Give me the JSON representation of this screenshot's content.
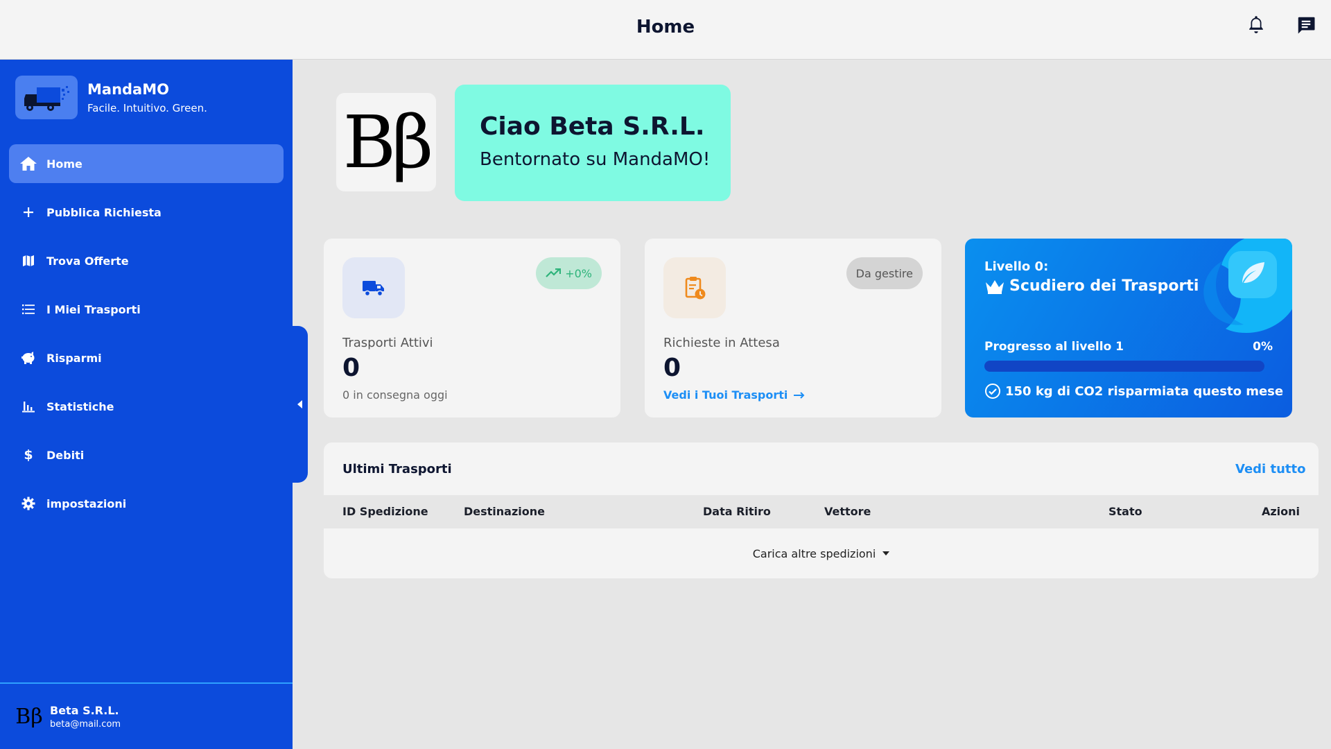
{
  "header": {
    "title": "Home"
  },
  "brand": {
    "name": "MandaMO",
    "tagline": "Facile. Intuitivo. Green."
  },
  "sidebar": {
    "items": [
      {
        "label": "Home",
        "icon": "home-icon",
        "active": true
      },
      {
        "label": "Pubblica Richiesta",
        "icon": "plus-icon"
      },
      {
        "label": "Trova Offerte",
        "icon": "map-icon"
      },
      {
        "label": "I Miei Trasporti",
        "icon": "list-icon"
      },
      {
        "label": "Risparmi",
        "icon": "piggy-bank-icon"
      },
      {
        "label": "Statistiche",
        "icon": "bar-chart-icon"
      },
      {
        "label": "Debiti",
        "icon": "dollar-icon"
      },
      {
        "label": "impostazioni",
        "icon": "gear-icon"
      }
    ]
  },
  "user": {
    "name": "Beta S.R.L.",
    "email": "beta@mail.com",
    "logo_text": "Bβ"
  },
  "greeting": {
    "title": "Ciao Beta S.R.L.",
    "subtitle": "Bentornato su MandaMO!"
  },
  "cards": {
    "active": {
      "label": "Trasporti Attivi",
      "value": "0",
      "footer": "0 in consegna oggi",
      "badge": "+0%"
    },
    "pending": {
      "label": "Richieste in Attesa",
      "value": "0",
      "link": "Vedi i Tuoi Trasporti",
      "badge": "Da gestire"
    }
  },
  "level": {
    "label": "Livello 0:",
    "name": "Scudiero dei Trasporti",
    "progress_label": "Progresso al livello 1",
    "progress_pct": "0%",
    "progress_value": 0,
    "co2": "150 kg di CO2 risparmiata questo mese"
  },
  "transports": {
    "title": "Ultimi Trasporti",
    "view_all": "Vedi tutto",
    "columns": [
      "ID Spedizione",
      "Destinazione",
      "Data Ritiro",
      "Vettore",
      "Stato",
      "Azioni"
    ],
    "load_more": "Carica altre spedizioni"
  },
  "colors": {
    "sidebar": "#0c4bdc",
    "accent": "#1c8ef5",
    "greeting_bg": "#7ffae2",
    "success": "#2db37a",
    "warning": "#ef8a1d"
  }
}
